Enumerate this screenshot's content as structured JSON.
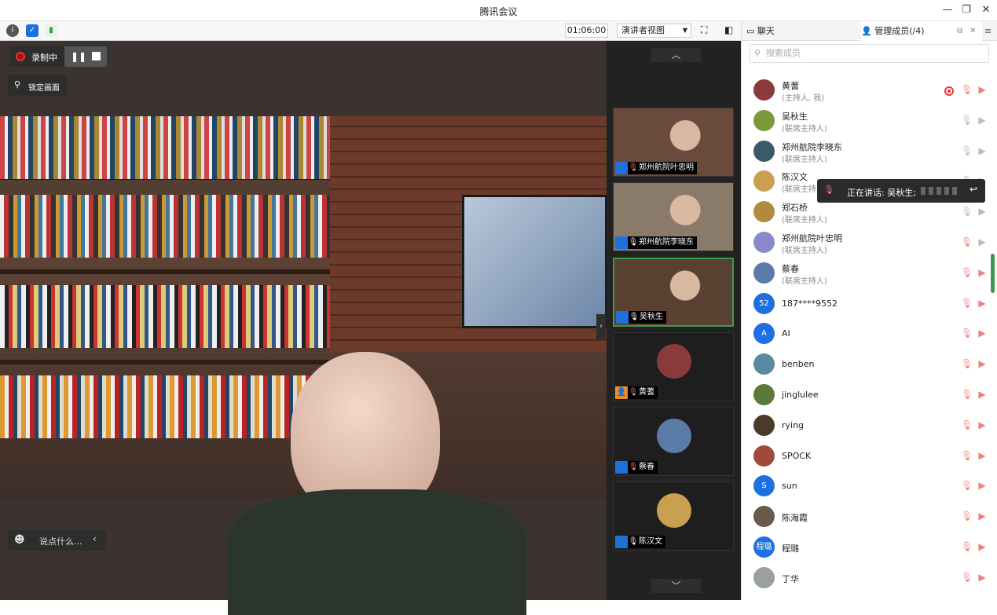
{
  "window": {
    "title": "腾讯会议"
  },
  "toolbar": {
    "timer": "01:06:00",
    "view_mode": "演讲者视图"
  },
  "recording": {
    "status": "录制中"
  },
  "main": {
    "lock_label": "锁定画面",
    "chat_placeholder": "说点什么..."
  },
  "panel": {
    "tab_chat": "聊天",
    "tab_members": "管理成员(/4)",
    "search_placeholder": "搜索成员",
    "speaking_label": "正在讲话: 吴秋生;",
    "members": [
      {
        "name": "黄蓍",
        "role": "(主持人, 我)",
        "avatar_color": "#8a3a3a",
        "mic": "muted",
        "video": "muted",
        "recording": true
      },
      {
        "name": "吴秋生",
        "role": "(联席主持人)",
        "avatar_color": "#7a9a3a",
        "mic": "unmuted",
        "video": "unmuted"
      },
      {
        "name": "郑州航院李晓东",
        "role": "(联席主持人)",
        "avatar_color": "#3a5a6a",
        "mic": "unmuted",
        "video": "unmuted"
      },
      {
        "name": "陈汉文",
        "role": "(联席主持人)",
        "avatar_color": "#c8a050",
        "mic": "unmuted",
        "video": "unmuted"
      },
      {
        "name": "郑石桥",
        "role": "(联席主持人)",
        "avatar_color": "#b08a40",
        "mic": "unmuted",
        "video": "unmuted"
      },
      {
        "name": "郑州航院叶忠明",
        "role": "(联席主持人)",
        "avatar_color": "#8a8ac8",
        "mic": "muted",
        "video": "unmuted"
      },
      {
        "name": "蔡春",
        "role": "(联席主持人)",
        "avatar_color": "#5a7aa8",
        "mic": "muted",
        "video": "muted"
      },
      {
        "name": "187****9552",
        "avatar_text": "52",
        "avatar_color": "#1e6fe0",
        "mic": "muted",
        "video": "muted"
      },
      {
        "name": "AI",
        "avatar_text": "A",
        "avatar_color": "#1e6fe0",
        "mic": "muted",
        "video": "muted"
      },
      {
        "name": "benben",
        "avatar_color": "#5a8aa0",
        "mic": "muted",
        "video": "muted"
      },
      {
        "name": "jinglulee",
        "avatar_color": "#5a7a3a",
        "mic": "muted",
        "video": "muted"
      },
      {
        "name": "rying",
        "avatar_color": "#4a3a2a",
        "mic": "muted",
        "video": "muted"
      },
      {
        "name": "SPOCK",
        "avatar_color": "#a04a3a",
        "mic": "muted",
        "video": "muted"
      },
      {
        "name": "sun",
        "avatar_text": "S",
        "avatar_color": "#1e6fe0",
        "mic": "muted",
        "video": "muted"
      },
      {
        "name": "陈海霞",
        "avatar_color": "#6a5a4a",
        "mic": "muted",
        "video": "muted"
      },
      {
        "name": "程璐",
        "avatar_text": "程璐",
        "avatar_color": "#1e6fe0",
        "mic": "muted",
        "video": "muted"
      },
      {
        "name": "丁华",
        "avatar_color": "#9aa0a0",
        "mic": "muted",
        "video": "muted"
      }
    ]
  },
  "thumbnails": [
    {
      "name": "郑州航院叶忠明",
      "mic": "muted",
      "cam_color": "#6a4a3a"
    },
    {
      "name": "郑州航院李晓东",
      "mic": "unmuted",
      "cam_color": "#8a7a6a"
    },
    {
      "name": "吴秋生",
      "mic": "unmuted",
      "cam_color": "#5a4030",
      "active": true
    },
    {
      "name": "黄蓍",
      "mic": "muted",
      "avatar_color": "#8a3a3a",
      "orange": true
    },
    {
      "name": "蔡春",
      "mic": "muted",
      "avatar_color": "#5a7aa8"
    },
    {
      "name": "陈汉文",
      "mic": "unmuted",
      "avatar_color": "#c8a050"
    }
  ]
}
